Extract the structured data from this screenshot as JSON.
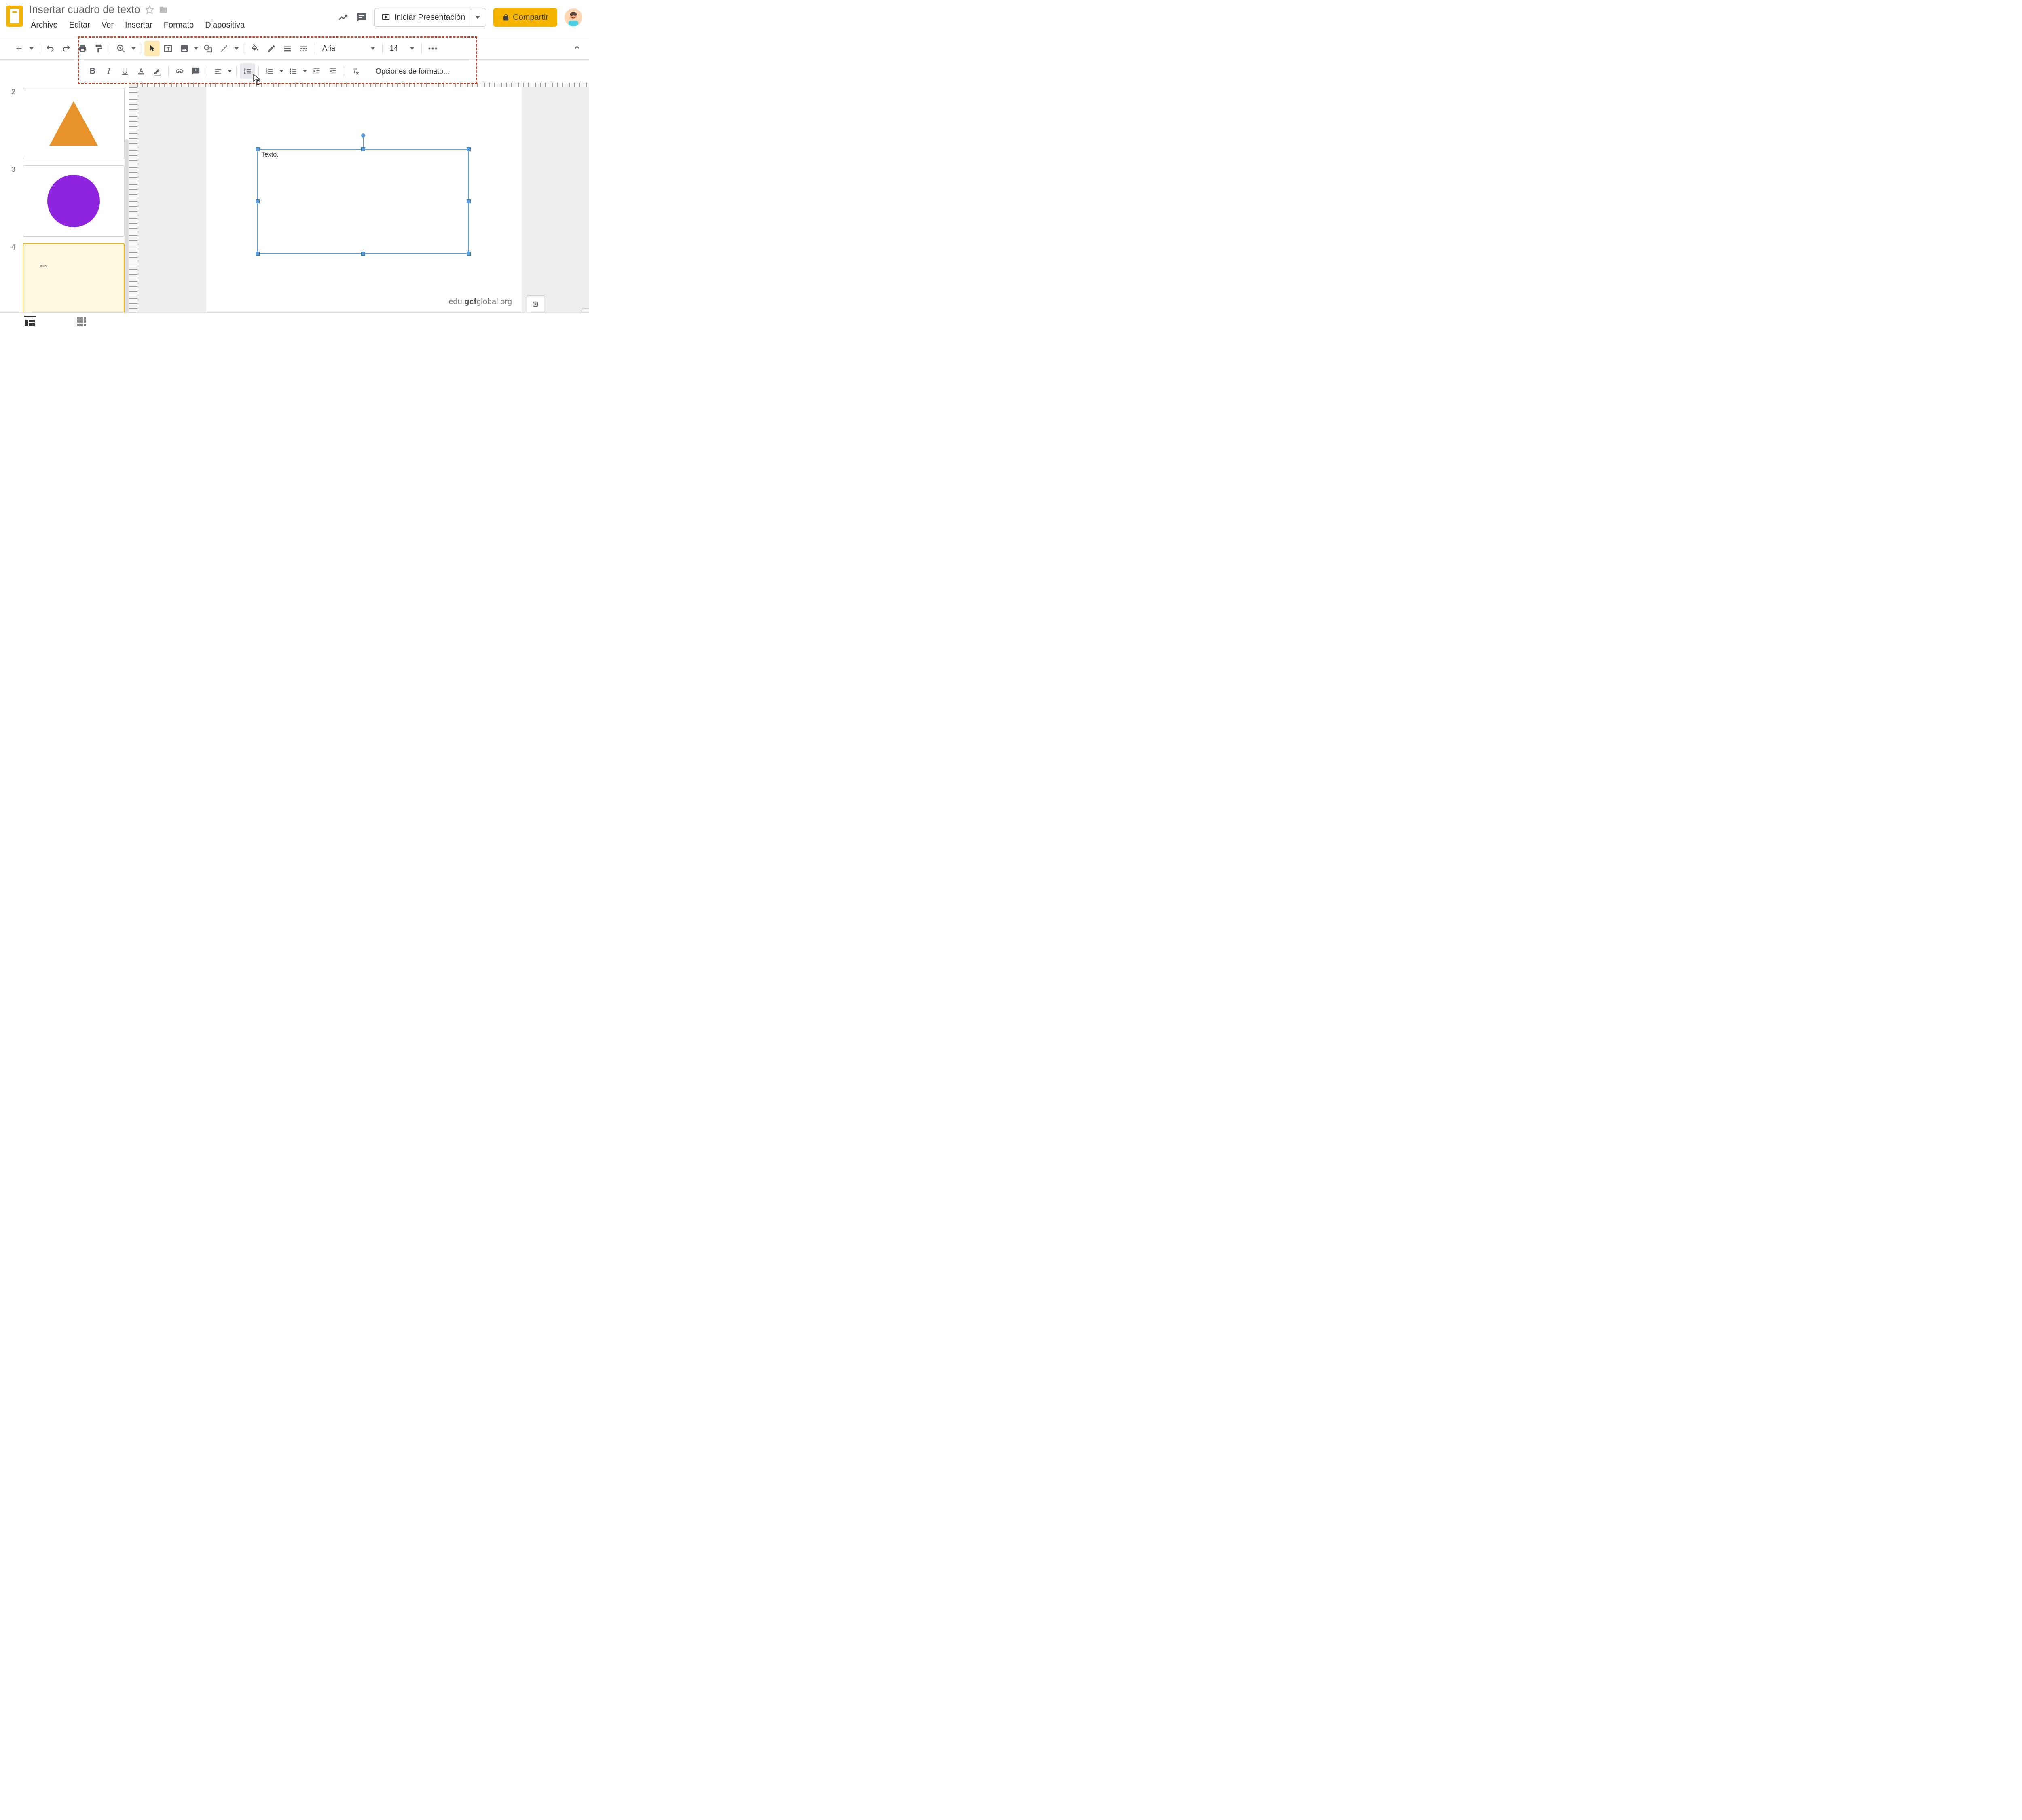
{
  "doc_title": "Insertar cuadro de texto",
  "menubar": {
    "archivo": "Archivo",
    "editar": "Editar",
    "ver": "Ver",
    "insertar": "Insertar",
    "formato": "Formato",
    "diapositiva": "Diapositiva"
  },
  "header": {
    "present": "Iniciar Presentación",
    "share": "Compartir"
  },
  "toolbar": {
    "font": "Arial",
    "size": "14",
    "format_options": "Opciones de formato..."
  },
  "slides": {
    "s2": "2",
    "s3": "3",
    "s4": "4",
    "thumb_text": "Texto."
  },
  "canvas": {
    "textbox_content": "Texto."
  },
  "watermark": {
    "pre": "edu.",
    "bold": "gcf",
    "post": "global.org"
  },
  "colors": {
    "accent": "#f4b400",
    "selection": "#5b9bd5",
    "orange_shape": "#e8922c",
    "purple_shape": "#8e24dd",
    "highlight_border": "#b84a2e"
  }
}
